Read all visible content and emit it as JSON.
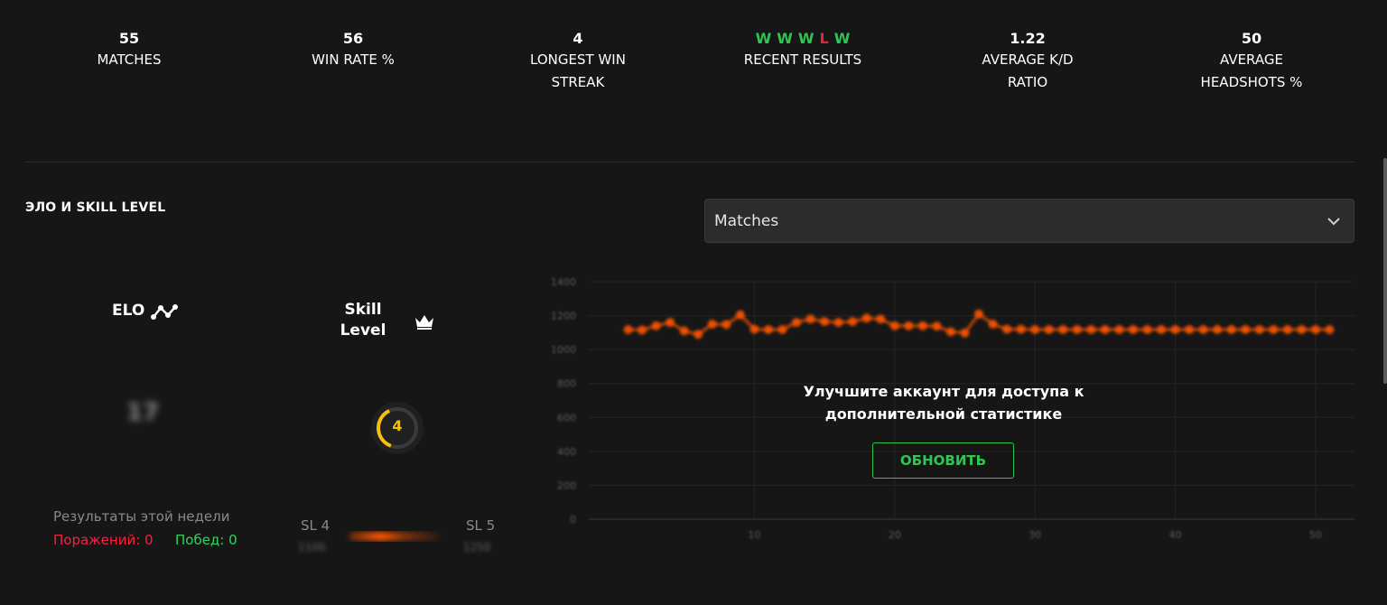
{
  "stats": [
    {
      "value": "55",
      "label": "MATCHES"
    },
    {
      "value": "56",
      "label": "WIN RATE %"
    },
    {
      "value": "4",
      "label": "LONGEST WIN STREAK"
    },
    {
      "value": "",
      "label": "RECENT RESULTS"
    },
    {
      "value": "1.22",
      "label": "AVERAGE K/D RATIO"
    },
    {
      "value": "50",
      "label": "AVERAGE HEADSHOTS %"
    }
  ],
  "recent_results": [
    "W",
    "W",
    "W",
    "L",
    "W"
  ],
  "colors": {
    "win": "#2fc651",
    "loss": "#e5243a",
    "accent": "#ff5500",
    "skill": "#f2c10f"
  },
  "section": {
    "title": "ЭЛО И SKILL LEVEL"
  },
  "dropdown": {
    "value": "Matches",
    "icon": "chevron-down-icon"
  },
  "elo": {
    "label": "ELO",
    "value": "17",
    "icon": "elo-graph-icon"
  },
  "skill": {
    "label": "Skill Level",
    "value": "4",
    "icon": "crown-icon"
  },
  "week": {
    "title": "Результаты этой недели",
    "losses": "Поражений: 0",
    "wins": "Побед: 0"
  },
  "skill_progress": {
    "left_label": "SL 4",
    "right_label": "SL 5",
    "left_value": "1100",
    "right_value": "1250"
  },
  "upgrade": {
    "text": "Улучшите аккаунт для доступа к дополнительной статистике",
    "button": "ОБНОВИТЬ"
  },
  "chart_data": {
    "type": "line",
    "ylim": [
      0,
      1400
    ],
    "y_ticks": [
      0,
      200,
      400,
      600,
      800,
      1000,
      1200,
      1400
    ],
    "xlim": [
      0,
      52
    ],
    "x_ticks": [
      10,
      20,
      30,
      40,
      50
    ],
    "x": [
      1,
      2,
      3,
      4,
      5,
      6,
      7,
      8,
      9,
      10,
      11,
      12,
      13,
      14,
      15,
      16,
      17,
      18,
      19,
      20,
      21,
      22,
      23,
      24,
      25,
      26,
      27,
      28,
      29,
      30,
      31,
      32,
      33,
      34,
      35,
      36,
      37,
      38,
      39,
      40,
      41,
      42,
      43,
      44,
      45,
      46,
      47,
      48,
      49,
      50,
      51
    ],
    "values": [
      1118,
      1115,
      1140,
      1160,
      1110,
      1090,
      1150,
      1148,
      1205,
      1120,
      1118,
      1118,
      1160,
      1180,
      1165,
      1160,
      1165,
      1185,
      1180,
      1140,
      1140,
      1140,
      1138,
      1105,
      1098,
      1210,
      1150,
      1120,
      1120,
      1118,
      1118,
      1118,
      1118,
      1118,
      1118,
      1118,
      1118,
      1118,
      1118,
      1118,
      1118,
      1118,
      1118,
      1118,
      1118,
      1118,
      1118,
      1118,
      1118,
      1118,
      1118
    ],
    "grid": true
  }
}
